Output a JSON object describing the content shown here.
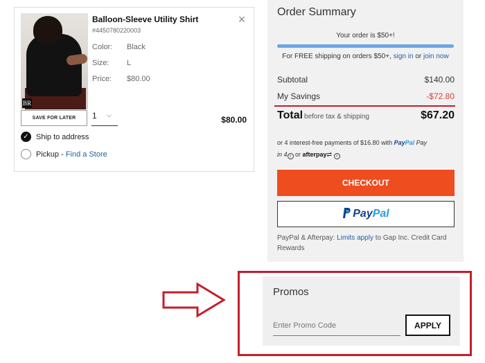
{
  "cart_item": {
    "name": "Balloon-Sleeve Utility Shirt",
    "sku": "#4450780220003",
    "brand_mark": "BR",
    "attributes": [
      {
        "label": "Color:",
        "value": "Black"
      },
      {
        "label": "Size:",
        "value": "L"
      },
      {
        "label": "Price:",
        "value": "$80.00"
      }
    ],
    "save_for_later_label": "SAVE FOR LATER",
    "quantity": "1",
    "line_total": "$80.00",
    "ship_to_address_label": "Ship to address",
    "pickup_label": "Pickup - ",
    "find_store_label": "Find a Store",
    "close_icon": "close-icon",
    "checked_icon": "checkmark-icon",
    "quantity_icon": "chevron-down-icon"
  },
  "summary": {
    "title": "Order Summary",
    "threshold_message": "Your order is $50+!",
    "shipping_progress_percent": 100,
    "free_shipping_text": "For FREE shipping on orders $50+, ",
    "sign_in_label": "sign in",
    "or_text": " or ",
    "join_now_label": "join now",
    "subtotal_label": "Subtotal",
    "subtotal_value": "$140.00",
    "savings_label": "My Savings",
    "savings_value": "-$72.80",
    "total_label": "Total",
    "total_sub": "before tax & shipping",
    "total_value": "$67.20",
    "installments_text": "or 4 interest-free payments of $16.80 with ",
    "paypal_pay_in4_prefix": "Pay",
    "paypal_pay_in4_name": "Pal",
    "paypal_pay_in4_suffix": "Pay",
    "in4_text": "in 4",
    "or_word": " or ",
    "afterpay_label": "afterpay",
    "info_glyph": "i",
    "checkout_label": "CHECKOUT",
    "paypal_button_part1": "Pay",
    "paypal_button_part2": "Pal",
    "footer_prefix": "PayPal & Afterpay: ",
    "limits_apply_label": "Limits apply",
    "footer_suffix": " to Gap Inc. Credit Card Rewards",
    "accent_color": "#ee4d1f",
    "savings_color": "#d4403a"
  },
  "promos": {
    "title": "Promos",
    "input_placeholder": "Enter Promo Code",
    "input_value": "",
    "apply_label": "APPLY",
    "annotation_color": "#c41d2b"
  }
}
